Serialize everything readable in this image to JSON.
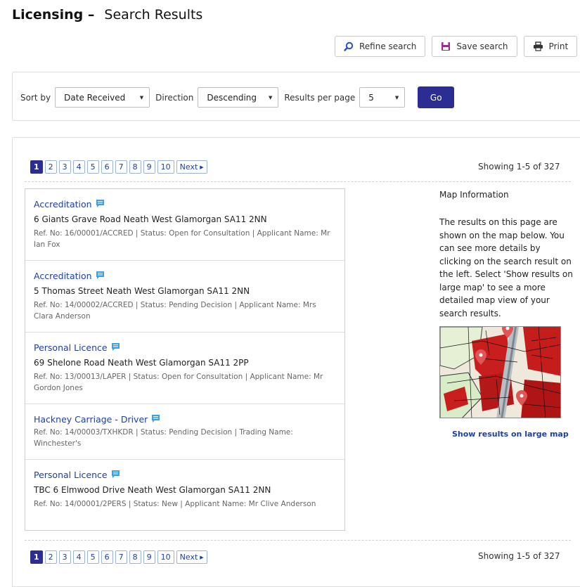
{
  "header": {
    "title_strong": "Licensing –",
    "title_sub": "Search Results"
  },
  "toolbar": {
    "refine_label": "Refine search",
    "save_label": "Save search",
    "print_label": "Print"
  },
  "sort": {
    "sort_by_label": "Sort by",
    "sort_by_value": "Date Received",
    "direction_label": "Direction",
    "direction_value": "Descending",
    "rpp_label": "Results per page",
    "rpp_value": "5",
    "go_label": "Go"
  },
  "pagination": {
    "pages": [
      "1",
      "2",
      "3",
      "4",
      "5",
      "6",
      "7",
      "8",
      "9",
      "10"
    ],
    "current_page": "1",
    "next_label": "Next",
    "showing": "Showing 1-5 of 327"
  },
  "results": [
    {
      "title": "Accreditation",
      "address": "6 Giants Grave Road Neath West Glamorgan SA11 2NN",
      "meta": "Ref. No: 16/00001/ACCRED | Status: Open for Consultation | Applicant Name: Mr Ian Fox"
    },
    {
      "title": "Accreditation",
      "address": "5 Thomas Street Neath West Glamorgan SA11 2NN",
      "meta": "Ref. No: 14/00002/ACCRED | Status: Pending Decision | Applicant Name: Mrs Clara Anderson"
    },
    {
      "title": "Personal Licence",
      "address": "69 Shelone Road Neath West Glamorgan SA11 2PP",
      "meta": "Ref. No: 13/00013/LAPER | Status: Open for Consultation | Applicant Name: Mr Gordon Jones"
    },
    {
      "title": "Hackney Carriage - Driver",
      "address": "",
      "meta": "Ref. No: 14/00003/TXHKDR | Status: Pending Decision | Trading Name: Winchester's"
    },
    {
      "title": "Personal Licence",
      "address": "TBC 6 Elmwood Drive Neath West Glamorgan SA11 2NN",
      "meta": "Ref. No: 14/00001/2PERS | Status: New | Applicant Name: Mr Clive Anderson"
    }
  ],
  "map": {
    "title": "Map Information",
    "text": "The results on this page are shown on the map below. You can see more details by clicking on the search result on the left. Select 'Show results on large map' to see a more detailed map view of your search results.",
    "link_label": "Show results on large map"
  },
  "colors": {
    "accent": "#2b2d92",
    "link": "#1c3fa6",
    "comment_icon": "#3aa0e8",
    "pin": "#e05555"
  },
  "icons": {
    "refine": "search-icon",
    "save": "floppy-disk-icon",
    "print": "printer-icon",
    "result": "comment-icon",
    "map_marker": "map-pin-icon"
  }
}
